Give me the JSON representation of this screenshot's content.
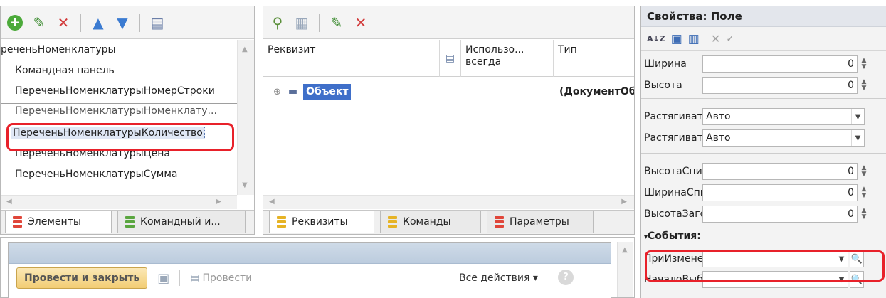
{
  "elements_panel": {
    "items": [
      "реченьНоменклатуры",
      "Командная панель",
      "ПереченьНоменклатурыНомерСтроки",
      "ПереченьНоменклатурыНоменклату...",
      "ПереченьНоменклатурыКоличество",
      "ПереченьНоменклатурыЦена",
      "ПереченьНоменклатурыСумма"
    ],
    "selected_index": 4,
    "tabs": [
      "Элементы",
      "Командный и..."
    ]
  },
  "attributes_panel": {
    "columns": [
      "Реквизит",
      "Использо... всегда",
      "Тип"
    ],
    "row": {
      "name": "Объект",
      "type": "(ДокументОб"
    },
    "tabs": [
      "Реквизиты",
      "Команды",
      "Параметры"
    ]
  },
  "properties_panel": {
    "title": "Свойства: Поле",
    "props": [
      {
        "label": "Ширина",
        "value": "0"
      },
      {
        "label": "Высота",
        "value": "0"
      },
      {
        "label": "РастягиватьI",
        "value": "Авто"
      },
      {
        "label": "РастягиватьI",
        "value": "Авто"
      },
      {
        "label": "ВысотаСписк",
        "value": "0"
      },
      {
        "label": "ШиринаСписк",
        "value": "0"
      },
      {
        "label": "ВысотаЗагол",
        "value": "0"
      }
    ],
    "events_title": "События:",
    "events": [
      {
        "label": "ПриИзменен",
        "value": ""
      },
      {
        "label": "НачалоВыбор",
        "value": ""
      }
    ]
  },
  "preview": {
    "primary_button": "Провести и закрыть",
    "post_button": "Провести",
    "all_actions": "Все действия ▾",
    "help": "?"
  },
  "colors": {
    "highlight": "#e8212a",
    "selection": "#3f6fc9"
  }
}
